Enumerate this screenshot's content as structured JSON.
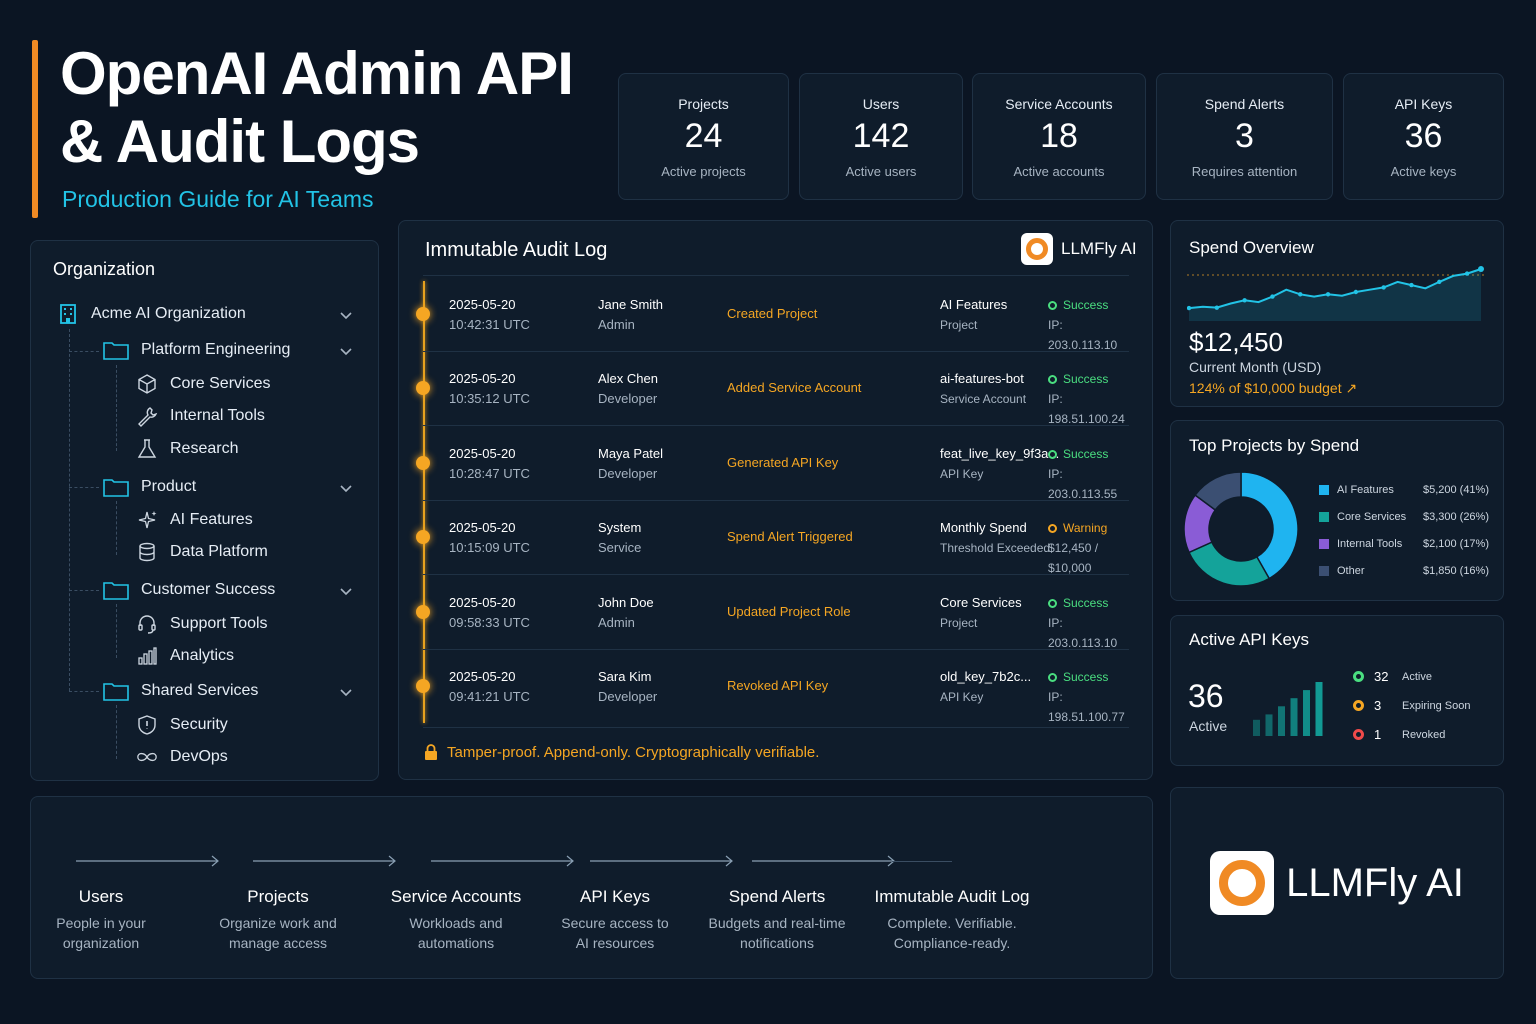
{
  "header": {
    "title_line1": "OpenAI Admin API",
    "title_line2": "& Audit Logs",
    "subtitle": "Production Guide for AI Teams"
  },
  "stats": [
    {
      "label": "Projects",
      "value": "24",
      "sub": "Active projects"
    },
    {
      "label": "Users",
      "value": "142",
      "sub": "Active users"
    },
    {
      "label": "Service Accounts",
      "value": "18",
      "sub": "Active accounts"
    },
    {
      "label": "Spend Alerts",
      "value": "3",
      "sub": "Requires attention"
    },
    {
      "label": "API Keys",
      "value": "36",
      "sub": "Active keys"
    }
  ],
  "organization": {
    "title": "Organization",
    "root": "Acme AI Organization",
    "groups": [
      {
        "name": "Platform Engineering",
        "items": [
          "Core Services",
          "Internal Tools",
          "Research"
        ]
      },
      {
        "name": "Product",
        "items": [
          "AI Features",
          "Data Platform"
        ]
      },
      {
        "name": "Customer Success",
        "items": [
          "Support Tools",
          "Analytics"
        ]
      },
      {
        "name": "Shared Services",
        "items": [
          "Security",
          "DevOps"
        ]
      }
    ]
  },
  "audit": {
    "title": "Immutable Audit Log",
    "brand": "LLMFly AI",
    "footer": "Tamper-proof. Append-only. Cryptographically verifiable.",
    "rows": [
      {
        "date": "2025-05-20",
        "time": "10:42:31 UTC",
        "actor": "Jane Smith",
        "role": "Admin",
        "action": "Created Project",
        "target": "AI Features",
        "target_type": "Project",
        "status": "Success",
        "detail": "IP: 203.0.113.10"
      },
      {
        "date": "2025-05-20",
        "time": "10:35:12 UTC",
        "actor": "Alex Chen",
        "role": "Developer",
        "action": "Added Service Account",
        "target": "ai-features-bot",
        "target_type": "Service Account",
        "status": "Success",
        "detail": "IP: 198.51.100.24"
      },
      {
        "date": "2025-05-20",
        "time": "10:28:47 UTC",
        "actor": "Maya Patel",
        "role": "Developer",
        "action": "Generated API Key",
        "target": "feat_live_key_9f3a...",
        "target_type": "API Key",
        "status": "Success",
        "detail": "IP: 203.0.113.55"
      },
      {
        "date": "2025-05-20",
        "time": "10:15:09 UTC",
        "actor": "System",
        "role": "Service",
        "action": "Spend Alert Triggered",
        "target": "Monthly Spend",
        "target_type": "Threshold Exceeded",
        "status": "Warning",
        "detail": "$12,450 / $10,000"
      },
      {
        "date": "2025-05-20",
        "time": "09:58:33 UTC",
        "actor": "John Doe",
        "role": "Admin",
        "action": "Updated Project Role",
        "target": "Core Services",
        "target_type": "Project",
        "status": "Success",
        "detail": "IP: 203.0.113.10"
      },
      {
        "date": "2025-05-20",
        "time": "09:41:21 UTC",
        "actor": "Sara Kim",
        "role": "Developer",
        "action": "Revoked API Key",
        "target": "old_key_7b2c...",
        "target_type": "API Key",
        "status": "Success",
        "detail": "IP: 198.51.100.77"
      }
    ]
  },
  "spend": {
    "title": "Spend Overview",
    "amount": "$12,450",
    "period": "Current Month (USD)",
    "budget": "124% of $10,000 budget ↗",
    "trend": [
      0.15,
      0.18,
      0.16,
      0.25,
      0.32,
      0.28,
      0.4,
      0.55,
      0.45,
      0.4,
      0.45,
      0.42,
      0.5,
      0.55,
      0.6,
      0.72,
      0.65,
      0.58,
      0.72,
      0.85,
      0.9,
      1.0
    ],
    "accent": "#22c3e6"
  },
  "top_projects": {
    "title": "Top Projects by Spend",
    "chart_data": {
      "type": "pie",
      "categories": [
        "AI Features",
        "Core Services",
        "Internal Tools",
        "Other"
      ],
      "values": [
        5200,
        3300,
        2100,
        1850
      ],
      "labels": [
        "$5,200 (41%)",
        "$3,300 (26%)",
        "$2,100 (17%)",
        "$1,850 (16%)"
      ],
      "colors": [
        "#1fb4f0",
        "#14a39a",
        "#8a5cd6",
        "#3b4f72"
      ]
    }
  },
  "api_keys": {
    "title": "Active API Keys",
    "value": "36",
    "value_label": "Active",
    "bars": [
      0.3,
      0.4,
      0.55,
      0.7,
      0.85,
      1.0
    ],
    "legend": [
      {
        "count": "32",
        "label": "Active",
        "color": "#4ade80"
      },
      {
        "count": "3",
        "label": "Expiring Soon",
        "color": "#f5a623"
      },
      {
        "count": "1",
        "label": "Revoked",
        "color": "#f04a4a"
      }
    ]
  },
  "flow": [
    {
      "title": "Users",
      "desc1": "People in your",
      "desc2": "organization"
    },
    {
      "title": "Projects",
      "desc1": "Organize work and",
      "desc2": "manage access"
    },
    {
      "title": "Service Accounts",
      "desc1": "Workloads and",
      "desc2": "automations"
    },
    {
      "title": "API Keys",
      "desc1": "Secure access to",
      "desc2": "AI resources"
    },
    {
      "title": "Spend Alerts",
      "desc1": "Budgets and real-time",
      "desc2": "notifications"
    },
    {
      "title": "Immutable Audit Log",
      "desc1": "Complete. Verifiable.",
      "desc2": "Compliance-ready."
    }
  ],
  "brand": {
    "name": "LLMFly AI",
    "color": "#f08a24"
  }
}
